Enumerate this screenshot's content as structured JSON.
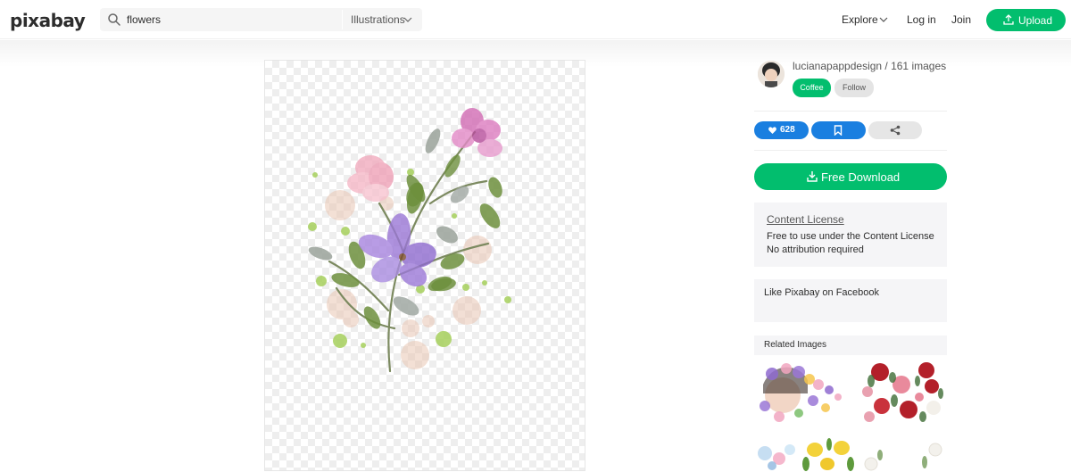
{
  "header": {
    "logo": "pixabay",
    "search_value": "flowers",
    "search_type": "Illustrations",
    "nav_explore": "Explore",
    "nav_login": "Log in",
    "nav_join": "Join",
    "upload_label": "Upload"
  },
  "author": {
    "text": "lucianapappdesign / 161 images",
    "coffee_label": "Coffee",
    "follow_label": "Follow"
  },
  "actions": {
    "like_count": "628",
    "download_label": "Free Download"
  },
  "license": {
    "title": "Content License",
    "line1": "Free to use under the Content License",
    "line2": "No attribution required"
  },
  "facebook": {
    "text": "Like Pixabay on Facebook"
  },
  "related": {
    "title": "Related Images"
  },
  "icons": [
    "search-icon",
    "chevron-down-icon",
    "upload-icon",
    "heart-icon",
    "bookmark-icon",
    "share-icon",
    "download-icon"
  ],
  "colors": {
    "brand_green": "#02be6e",
    "action_blue": "#1a7fe0"
  }
}
